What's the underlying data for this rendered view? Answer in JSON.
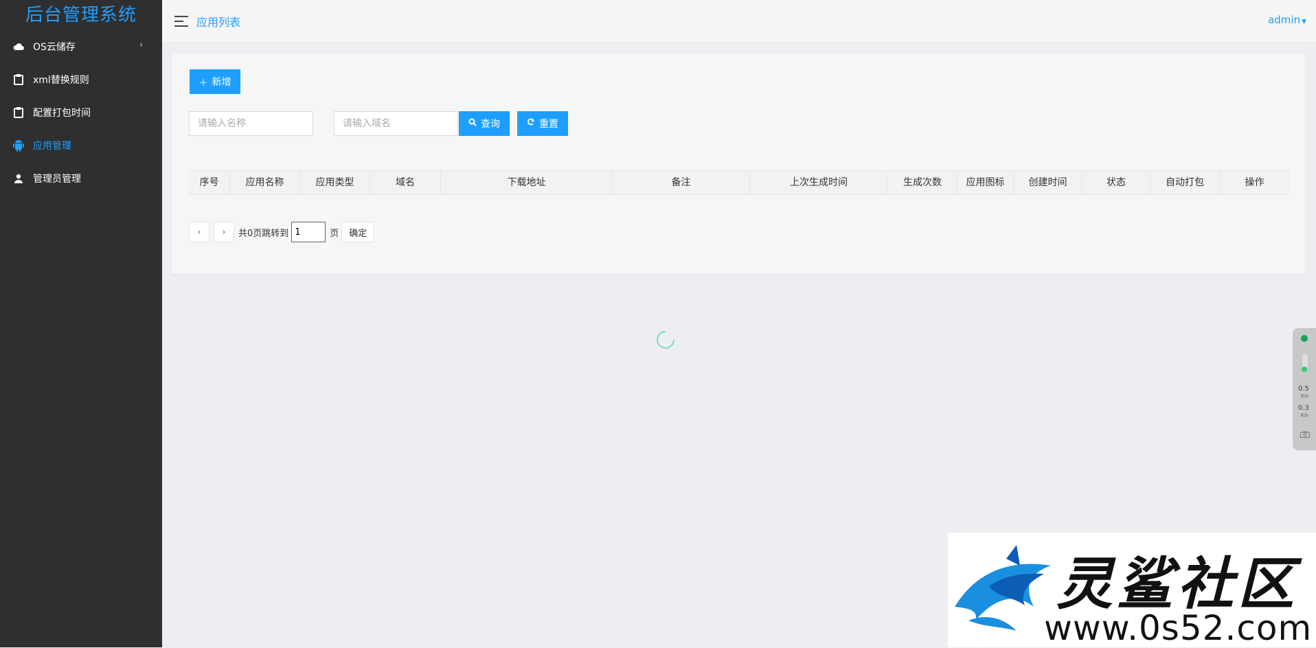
{
  "sidebar": {
    "brand": "后台管理系统",
    "items": [
      {
        "label": "OS云储存",
        "icon": "cloud-icon",
        "has_submenu": true
      },
      {
        "label": "xml替换规则",
        "icon": "clipboard-icon"
      },
      {
        "label": "配置打包时间",
        "icon": "clipboard-icon"
      },
      {
        "label": "应用管理",
        "icon": "android-icon",
        "active": true
      },
      {
        "label": "管理员管理",
        "icon": "user-icon"
      }
    ],
    "chevron": "›"
  },
  "header": {
    "page_title": "应用列表",
    "user": "admin"
  },
  "toolbar": {
    "add_label": "新增",
    "name_placeholder": "请输入名称",
    "domain_placeholder": "请输入域名",
    "query_label": "查询",
    "reset_label": "重置"
  },
  "table": {
    "columns": [
      "序号",
      "应用名称",
      "应用类型",
      "域名",
      "下载地址",
      "备注",
      "上次生成时间",
      "生成次数",
      "应用图标",
      "创建时间",
      "状态",
      "自动打包",
      "操作"
    ]
  },
  "pagination": {
    "prev": "‹",
    "next": "›",
    "total_text": "共0页跳转到",
    "page_value": "1",
    "page_unit": "页",
    "confirm_label": "确定"
  },
  "widget": {
    "upload_speed": "0.5",
    "download_speed": "0.3",
    "unit": "K/s"
  },
  "watermark": {
    "cn": "灵鲨社区",
    "url": "www.0s52.com"
  },
  "colors": {
    "accent": "#1e9fff",
    "sidebar_bg": "#2f2f2f",
    "page_bg": "#edeef1"
  }
}
